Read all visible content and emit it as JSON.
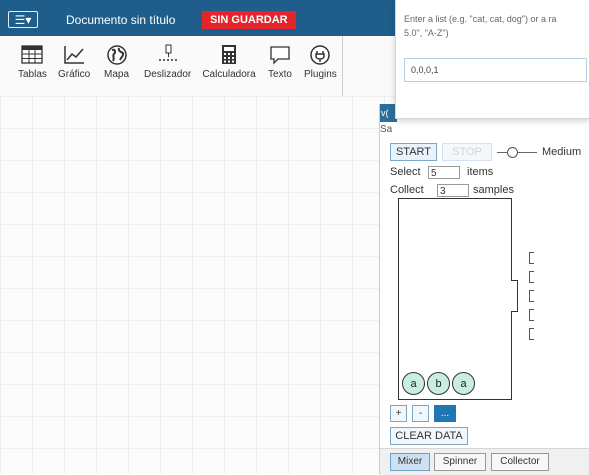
{
  "header": {
    "menu_icon": "hamburger-menu-icon",
    "menu_label": "☰▾",
    "document_title": "Documento sin título",
    "unsaved_badge": "SIN GUARDAR"
  },
  "toolbar": {
    "items": [
      {
        "label": "Tablas",
        "icon": "table-icon"
      },
      {
        "label": "Gráfico",
        "icon": "graph-icon"
      },
      {
        "label": "Mapa",
        "icon": "globe-icon"
      },
      {
        "label": "Deslizador",
        "icon": "slider-icon"
      },
      {
        "label": "Calculadora",
        "icon": "calculator-icon"
      },
      {
        "label": "Texto",
        "icon": "text-icon"
      },
      {
        "label": "Plugins",
        "icon": "plugin-icon"
      }
    ]
  },
  "popup": {
    "help_line1": "Enter a list (e.g. \"cat, cat, dog\") or a ra",
    "help_line2": "5.0\", \"A-Z\")",
    "input_value": "0,0,0,1"
  },
  "sampler": {
    "title_fragment": "v(",
    "sub_fragment": "Sa",
    "start_label": "START",
    "stop_label": "STOP",
    "speed_label": "Medium",
    "select_label": "Select",
    "select_value": "5",
    "items_label": "items",
    "collect_label": "Collect",
    "collect_value": "3",
    "samples_label": "samples",
    "balls": [
      "a",
      "b",
      "a"
    ],
    "plus_label": "+",
    "minus_label": "-",
    "dots_label": "...",
    "clear_label": "CLEAR DATA",
    "tabs": [
      "Mixer",
      "Spinner",
      "Collector"
    ]
  }
}
